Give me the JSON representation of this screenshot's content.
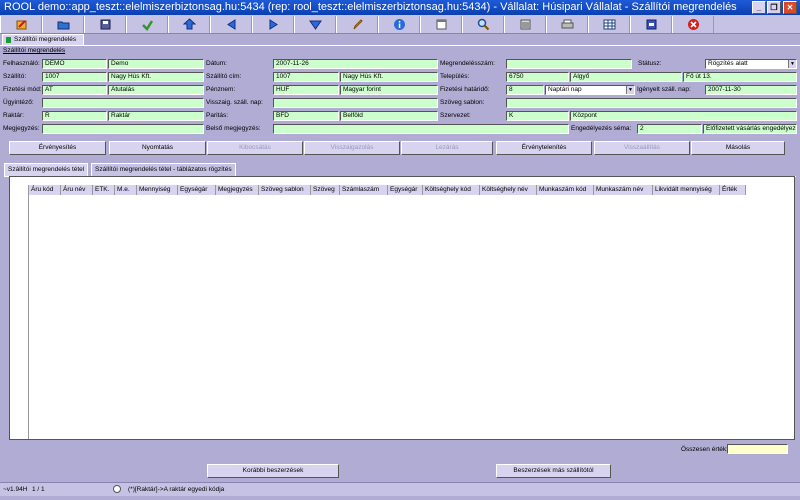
{
  "window": {
    "title": "ROOL demo::app_teszt::elelmiszerbiztonsag.hu:5434 (rep: rool_teszt::elelmiszerbiztonsag.hu:5434) - Vállalat: Húsipari Vállalat - Szállítói megrendelés",
    "buttons": {
      "minimize": "_",
      "maximize": "❐",
      "close": "✕"
    }
  },
  "toolbar": {
    "icons": [
      "edit-icon",
      "open-icon",
      "save-icon",
      "refresh-icon",
      "home-icon",
      "previous-icon",
      "next-icon",
      "last-icon",
      "pencil-icon",
      "info-icon",
      "calendar-icon",
      "search-icon",
      "list-icon",
      "print-icon",
      "grid-icon",
      "export-icon",
      "close-icon"
    ]
  },
  "main_tab": {
    "label": "Szállítói megrendelés"
  },
  "section": {
    "title": "Szállítói megrendelés"
  },
  "form": {
    "labels": {
      "felhasznalo": "Felhasználó:",
      "szallito": "Szállító:",
      "fizetesi_mod": "Fizetési mód:",
      "ugyintezo": "Ügyintéző:",
      "raktar": "Raktár:",
      "megjegyzes": "Megjegyzés:",
      "datum": "Dátum:",
      "szallito_cim": "Szállító cím:",
      "penznem": "Pénznem:",
      "visszaig": "Visszaig. száll. nap:",
      "paritas": "Paritás:",
      "belso_megjegyzes": "Belső megjegyzés:",
      "megrendelesszam": "Megrendelésszám:",
      "telepules": "Település:",
      "fizetesi_hatarido": "Fizetési határidő:",
      "szoveg_sablon": "Szöveg sablon:",
      "szervezet": "Szervezet:",
      "engedelyezes_sema": "Engedélyezés séma:",
      "statusz": "Státusz:",
      "igenyelt": "Igényelt száll. nap:"
    },
    "values": {
      "felhasznalo_code": "DEMO",
      "felhasznalo_name": "Demo",
      "szallito_code": "1007",
      "szallito_name": "Nagy Hús Kft.",
      "fizetesi_mod_code": "AT",
      "fizetesi_mod_name": "Átutalás",
      "ugyintezo": "",
      "raktar_code": "R",
      "raktar_name": "Raktár",
      "megjegyzes": "",
      "datum": "2007-11-26",
      "szallito_cim_code": "1007",
      "szallito_cim_name": "Nagy Hús Kft.",
      "penznem_code": "HUF",
      "penznem_name": "Magyar forint",
      "visszaig": "",
      "paritas_code": "BFD",
      "paritas_name": "Belföld",
      "belso_megjegyzes": "",
      "megrendelesszam": "",
      "telepules_zip": "6750",
      "telepules_name": "Algyő",
      "telepules_address": "Fő út 13.",
      "fizetesi_hatarido": "8",
      "fizetesi_hatarido_unit": "Naptári nap",
      "szoveg_sablon": "",
      "szervezet_code": "K",
      "szervezet_name": "Központ",
      "engedelyezes_sema_code": "2",
      "engedelyezes_sema_name": "Előfizetett vásárlás engedélyez",
      "statusz": "Rögzítés alatt",
      "igenyelt": "2007-11-30"
    }
  },
  "actions": [
    "Érvényesítés",
    "Nyomtatás",
    "Kibocsátás",
    "Visszaigazolás",
    "Lezárás",
    "Érvénytelenítés",
    "Visszaállítás",
    "Másolás"
  ],
  "sub_tabs": [
    "Szállítói megrendelés tétel",
    "Szállítói megrendelés tétel - táblázatos rögzítés"
  ],
  "table": {
    "columns": [
      "Áru kód",
      "Áru név",
      "ETK.",
      "M.e.",
      "Mennyiség",
      "Egységár",
      "Megjegyzés",
      "Szöveg sablon",
      "Szöveg",
      "Számlaszám",
      "Egységár",
      "Költséghely kód",
      "Költséghely név",
      "Munkaszám kód",
      "Munkaszám név",
      "Likvidált mennyiség",
      "Érték"
    ],
    "rows": []
  },
  "total": {
    "label": "Összesen érték:",
    "value": ""
  },
  "bottom_buttons": {
    "previous": "Korábbi beszerzések",
    "other": "Beszerzések más szállítótól"
  },
  "status": {
    "version": "~v1.94H",
    "page": "1 / 1",
    "hint": "(*)[Raktár]->A raktár egyedi kódja"
  }
}
